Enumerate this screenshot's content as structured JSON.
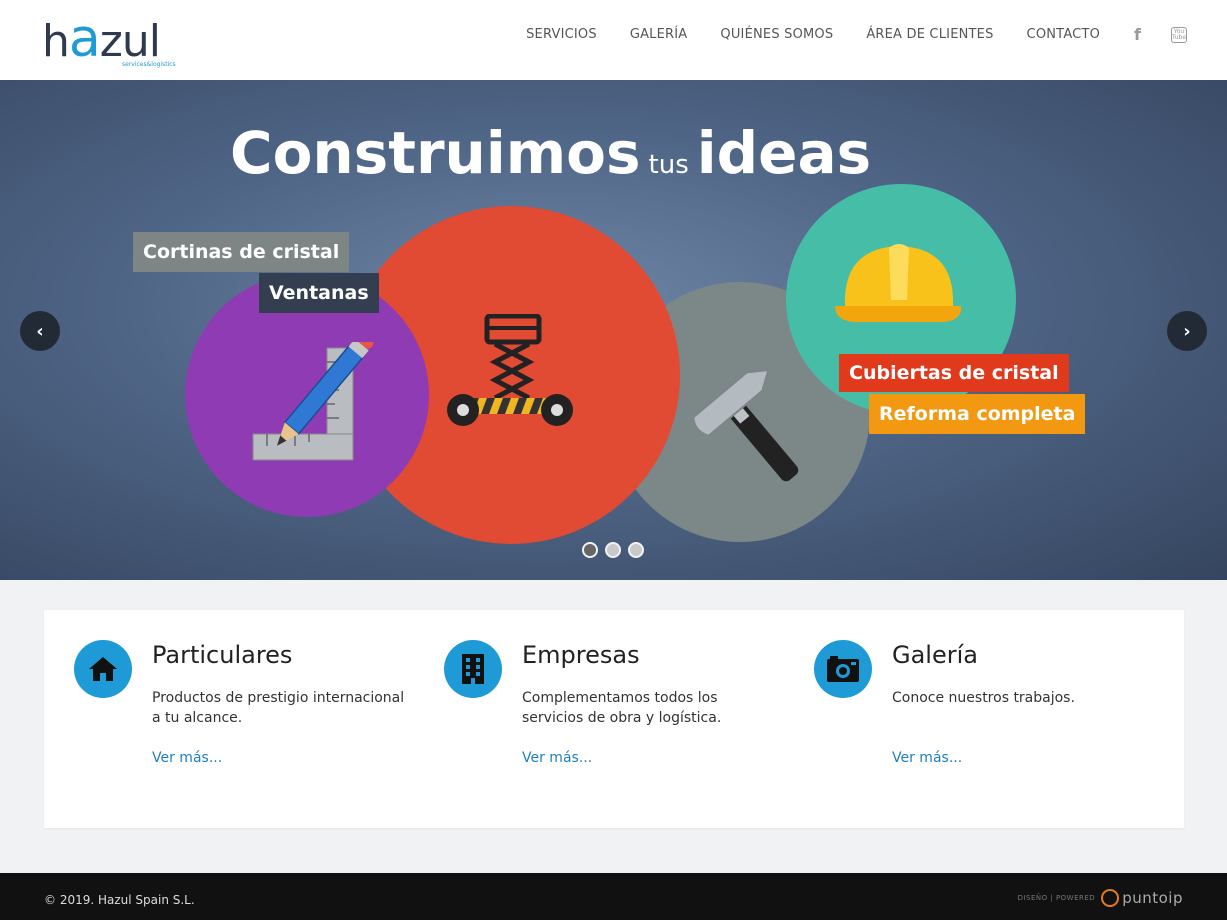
{
  "brand": {
    "logo_prefix": "h",
    "logo_a": "a",
    "logo_suffix": "zul",
    "logo_sub": "services&logistics",
    "accent_color": "#1e9ad6"
  },
  "nav": {
    "items": [
      "SERVICIOS",
      "GALERÍA",
      "QUIÉNES SOMOS",
      "ÁREA DE CLIENTES",
      "CONTACTO"
    ],
    "facebook_label": "f",
    "youtube_label": "You Tube"
  },
  "hero": {
    "title_part1": "Construimos",
    "title_part2": "tus",
    "title_part3": "ideas",
    "tags": [
      "Cortinas de cristal",
      "Ventanas",
      "Cubiertas de cristal",
      "Reforma completa"
    ],
    "prev_arrow": "‹",
    "next_arrow": "›",
    "slide_count": 3,
    "active_slide": 1,
    "icons": [
      "ruler-pencil-icon",
      "scissor-lift-icon",
      "hammer-icon",
      "hard-hat-icon"
    ]
  },
  "features": [
    {
      "title": "Particulares",
      "description": "Productos de prestigio internacional a tu alcance.",
      "link": "Ver más...",
      "icon": "home-icon"
    },
    {
      "title": "Empresas",
      "description": "Complementamos todos los servicios de obra y logística.",
      "link": "Ver más...",
      "icon": "building-icon"
    },
    {
      "title": "Galería",
      "description": "Conoce nuestros trabajos.",
      "link": "Ver más...",
      "icon": "camera-icon"
    }
  ],
  "footer": {
    "copyright": "© 2019. Hazul Spain S.L.",
    "powered_label": "DISEÑO | POWERED",
    "powered_brand": "puntoip"
  }
}
